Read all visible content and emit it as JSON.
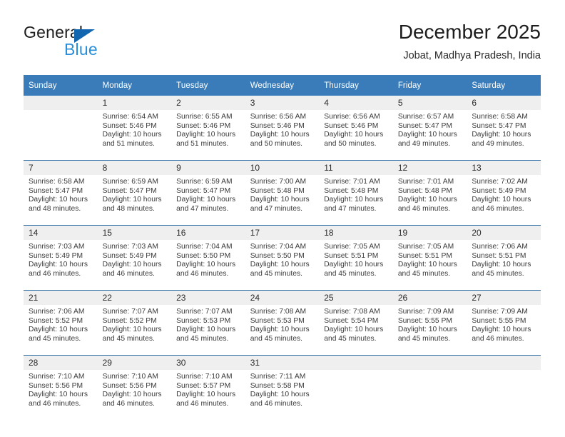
{
  "brand": {
    "name_top": "General",
    "name_bottom": "Blue",
    "triangle_color": "#1266b0",
    "blue_text_color": "#2a8fd8"
  },
  "header": {
    "title": "December 2025",
    "subtitle": "Jobat, Madhya Pradesh, India"
  },
  "theme": {
    "header_blue": "#3a7cba",
    "row_line_blue": "#2f6fa8",
    "daynum_band": "#efefef",
    "text": "#3a3a3a"
  },
  "calendar": {
    "weekdays": [
      "Sunday",
      "Monday",
      "Tuesday",
      "Wednesday",
      "Thursday",
      "Friday",
      "Saturday"
    ],
    "labels": {
      "sunrise_prefix": "Sunrise: ",
      "sunset_prefix": "Sunset: ",
      "daylight_prefix": "Daylight: "
    },
    "weeks": [
      [
        {
          "day": "",
          "sunrise": "",
          "sunset": "",
          "daylight": ""
        },
        {
          "day": "1",
          "sunrise": "Sunrise: 6:54 AM",
          "sunset": "Sunset: 5:46 PM",
          "daylight": "Daylight: 10 hours and 51 minutes."
        },
        {
          "day": "2",
          "sunrise": "Sunrise: 6:55 AM",
          "sunset": "Sunset: 5:46 PM",
          "daylight": "Daylight: 10 hours and 51 minutes."
        },
        {
          "day": "3",
          "sunrise": "Sunrise: 6:56 AM",
          "sunset": "Sunset: 5:46 PM",
          "daylight": "Daylight: 10 hours and 50 minutes."
        },
        {
          "day": "4",
          "sunrise": "Sunrise: 6:56 AM",
          "sunset": "Sunset: 5:46 PM",
          "daylight": "Daylight: 10 hours and 50 minutes."
        },
        {
          "day": "5",
          "sunrise": "Sunrise: 6:57 AM",
          "sunset": "Sunset: 5:47 PM",
          "daylight": "Daylight: 10 hours and 49 minutes."
        },
        {
          "day": "6",
          "sunrise": "Sunrise: 6:58 AM",
          "sunset": "Sunset: 5:47 PM",
          "daylight": "Daylight: 10 hours and 49 minutes."
        }
      ],
      [
        {
          "day": "7",
          "sunrise": "Sunrise: 6:58 AM",
          "sunset": "Sunset: 5:47 PM",
          "daylight": "Daylight: 10 hours and 48 minutes."
        },
        {
          "day": "8",
          "sunrise": "Sunrise: 6:59 AM",
          "sunset": "Sunset: 5:47 PM",
          "daylight": "Daylight: 10 hours and 48 minutes."
        },
        {
          "day": "9",
          "sunrise": "Sunrise: 6:59 AM",
          "sunset": "Sunset: 5:47 PM",
          "daylight": "Daylight: 10 hours and 47 minutes."
        },
        {
          "day": "10",
          "sunrise": "Sunrise: 7:00 AM",
          "sunset": "Sunset: 5:48 PM",
          "daylight": "Daylight: 10 hours and 47 minutes."
        },
        {
          "day": "11",
          "sunrise": "Sunrise: 7:01 AM",
          "sunset": "Sunset: 5:48 PM",
          "daylight": "Daylight: 10 hours and 47 minutes."
        },
        {
          "day": "12",
          "sunrise": "Sunrise: 7:01 AM",
          "sunset": "Sunset: 5:48 PM",
          "daylight": "Daylight: 10 hours and 46 minutes."
        },
        {
          "day": "13",
          "sunrise": "Sunrise: 7:02 AM",
          "sunset": "Sunset: 5:49 PM",
          "daylight": "Daylight: 10 hours and 46 minutes."
        }
      ],
      [
        {
          "day": "14",
          "sunrise": "Sunrise: 7:03 AM",
          "sunset": "Sunset: 5:49 PM",
          "daylight": "Daylight: 10 hours and 46 minutes."
        },
        {
          "day": "15",
          "sunrise": "Sunrise: 7:03 AM",
          "sunset": "Sunset: 5:49 PM",
          "daylight": "Daylight: 10 hours and 46 minutes."
        },
        {
          "day": "16",
          "sunrise": "Sunrise: 7:04 AM",
          "sunset": "Sunset: 5:50 PM",
          "daylight": "Daylight: 10 hours and 46 minutes."
        },
        {
          "day": "17",
          "sunrise": "Sunrise: 7:04 AM",
          "sunset": "Sunset: 5:50 PM",
          "daylight": "Daylight: 10 hours and 45 minutes."
        },
        {
          "day": "18",
          "sunrise": "Sunrise: 7:05 AM",
          "sunset": "Sunset: 5:51 PM",
          "daylight": "Daylight: 10 hours and 45 minutes."
        },
        {
          "day": "19",
          "sunrise": "Sunrise: 7:05 AM",
          "sunset": "Sunset: 5:51 PM",
          "daylight": "Daylight: 10 hours and 45 minutes."
        },
        {
          "day": "20",
          "sunrise": "Sunrise: 7:06 AM",
          "sunset": "Sunset: 5:51 PM",
          "daylight": "Daylight: 10 hours and 45 minutes."
        }
      ],
      [
        {
          "day": "21",
          "sunrise": "Sunrise: 7:06 AM",
          "sunset": "Sunset: 5:52 PM",
          "daylight": "Daylight: 10 hours and 45 minutes."
        },
        {
          "day": "22",
          "sunrise": "Sunrise: 7:07 AM",
          "sunset": "Sunset: 5:52 PM",
          "daylight": "Daylight: 10 hours and 45 minutes."
        },
        {
          "day": "23",
          "sunrise": "Sunrise: 7:07 AM",
          "sunset": "Sunset: 5:53 PM",
          "daylight": "Daylight: 10 hours and 45 minutes."
        },
        {
          "day": "24",
          "sunrise": "Sunrise: 7:08 AM",
          "sunset": "Sunset: 5:53 PM",
          "daylight": "Daylight: 10 hours and 45 minutes."
        },
        {
          "day": "25",
          "sunrise": "Sunrise: 7:08 AM",
          "sunset": "Sunset: 5:54 PM",
          "daylight": "Daylight: 10 hours and 45 minutes."
        },
        {
          "day": "26",
          "sunrise": "Sunrise: 7:09 AM",
          "sunset": "Sunset: 5:55 PM",
          "daylight": "Daylight: 10 hours and 45 minutes."
        },
        {
          "day": "27",
          "sunrise": "Sunrise: 7:09 AM",
          "sunset": "Sunset: 5:55 PM",
          "daylight": "Daylight: 10 hours and 46 minutes."
        }
      ],
      [
        {
          "day": "28",
          "sunrise": "Sunrise: 7:10 AM",
          "sunset": "Sunset: 5:56 PM",
          "daylight": "Daylight: 10 hours and 46 minutes."
        },
        {
          "day": "29",
          "sunrise": "Sunrise: 7:10 AM",
          "sunset": "Sunset: 5:56 PM",
          "daylight": "Daylight: 10 hours and 46 minutes."
        },
        {
          "day": "30",
          "sunrise": "Sunrise: 7:10 AM",
          "sunset": "Sunset: 5:57 PM",
          "daylight": "Daylight: 10 hours and 46 minutes."
        },
        {
          "day": "31",
          "sunrise": "Sunrise: 7:11 AM",
          "sunset": "Sunset: 5:58 PM",
          "daylight": "Daylight: 10 hours and 46 minutes."
        },
        {
          "day": "",
          "sunrise": "",
          "sunset": "",
          "daylight": ""
        },
        {
          "day": "",
          "sunrise": "",
          "sunset": "",
          "daylight": ""
        },
        {
          "day": "",
          "sunrise": "",
          "sunset": "",
          "daylight": ""
        }
      ]
    ]
  }
}
